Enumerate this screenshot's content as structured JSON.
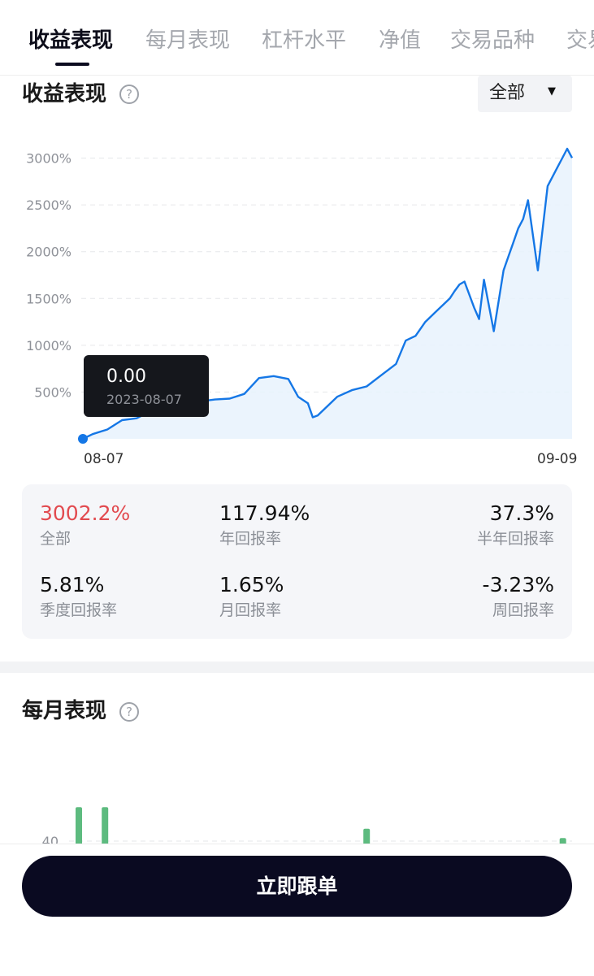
{
  "tabs": [
    {
      "label": "收益表现",
      "active": true
    },
    {
      "label": "每月表现",
      "active": false
    },
    {
      "label": "杠杆水平",
      "active": false
    },
    {
      "label": "净值",
      "active": false
    },
    {
      "label": "交易品种",
      "active": false
    },
    {
      "label": "交易",
      "active": false
    }
  ],
  "performance": {
    "title": "收益表现",
    "help_icon": "question-circle-icon",
    "range_select": {
      "value": "全部",
      "caret_icon": "caret-down-icon"
    },
    "tooltip": {
      "value": "0.00",
      "date": "2023-08-07"
    },
    "x_start": "08-07",
    "x_end": "09-09"
  },
  "stats": [
    {
      "value": "3002.2%",
      "label": "全部",
      "highlight": true
    },
    {
      "value": "117.94%",
      "label": "年回报率"
    },
    {
      "value": "37.3%",
      "label": "半年回报率"
    },
    {
      "value": "5.81%",
      "label": "季度回报率"
    },
    {
      "value": "1.65%",
      "label": "月回报率"
    },
    {
      "value": "-3.23%",
      "label": "周回报率"
    }
  ],
  "monthly": {
    "title": "每月表现",
    "help_icon": "question-circle-icon"
  },
  "follow_button": {
    "label": "立即跟单"
  },
  "colors": {
    "line": "#1577e6",
    "area": "#e8f2fd",
    "positive_highlight": "#e24a4f",
    "bar": "#5dbb7f",
    "button_bg": "#0a0a21"
  },
  "chart_data": [
    {
      "type": "area",
      "title": "",
      "xlabel": "",
      "ylabel": "",
      "y_tick_labels": [
        "500%",
        "1000%",
        "1500%",
        "2000%",
        "2500%",
        "3000%"
      ],
      "y_ticks": [
        500,
        1000,
        1500,
        2000,
        2500,
        3000
      ],
      "ylim": [
        0,
        3300
      ],
      "x_labels": [
        "08-07",
        "09-09"
      ],
      "x": [
        0,
        0.02,
        0.05,
        0.08,
        0.11,
        0.14,
        0.17,
        0.2,
        0.24,
        0.27,
        0.3,
        0.33,
        0.36,
        0.39,
        0.42,
        0.44,
        0.46,
        0.47,
        0.48,
        0.5,
        0.52,
        0.55,
        0.58,
        0.61,
        0.64,
        0.66,
        0.68,
        0.7,
        0.72,
        0.74,
        0.75,
        0.76,
        0.77,
        0.78,
        0.8,
        0.81,
        0.82,
        0.84,
        0.86,
        0.87,
        0.88,
        0.89,
        0.9,
        0.91,
        0.93,
        0.95,
        0.96,
        0.97,
        0.98,
        0.99,
        1.0
      ],
      "series": [
        {
          "values": [
            0,
            50,
            100,
            200,
            220,
            300,
            350,
            380,
            400,
            420,
            430,
            480,
            650,
            670,
            640,
            450,
            380,
            230,
            250,
            350,
            450,
            520,
            560,
            680,
            800,
            1050,
            1100,
            1250,
            1350,
            1450,
            1500,
            1580,
            1650,
            1680,
            1400,
            1280,
            1700,
            1150,
            1800,
            1950,
            2100,
            2250,
            2350,
            2550,
            1800,
            2700,
            2800,
            2900,
            3000,
            3100,
            3002
          ]
        }
      ]
    },
    {
      "type": "bar",
      "title": "",
      "y_tick_labels": [
        "40"
      ],
      "y_ticks": [
        40
      ],
      "values": [
        62,
        14,
        62,
        0,
        0,
        0,
        0,
        0,
        0,
        0,
        0,
        0,
        0,
        0,
        0,
        0,
        32,
        0,
        0,
        0,
        0,
        16,
        48,
        0,
        0,
        0,
        32,
        0,
        0,
        0,
        0,
        0,
        0,
        0,
        12,
        0,
        0,
        42
      ]
    }
  ]
}
